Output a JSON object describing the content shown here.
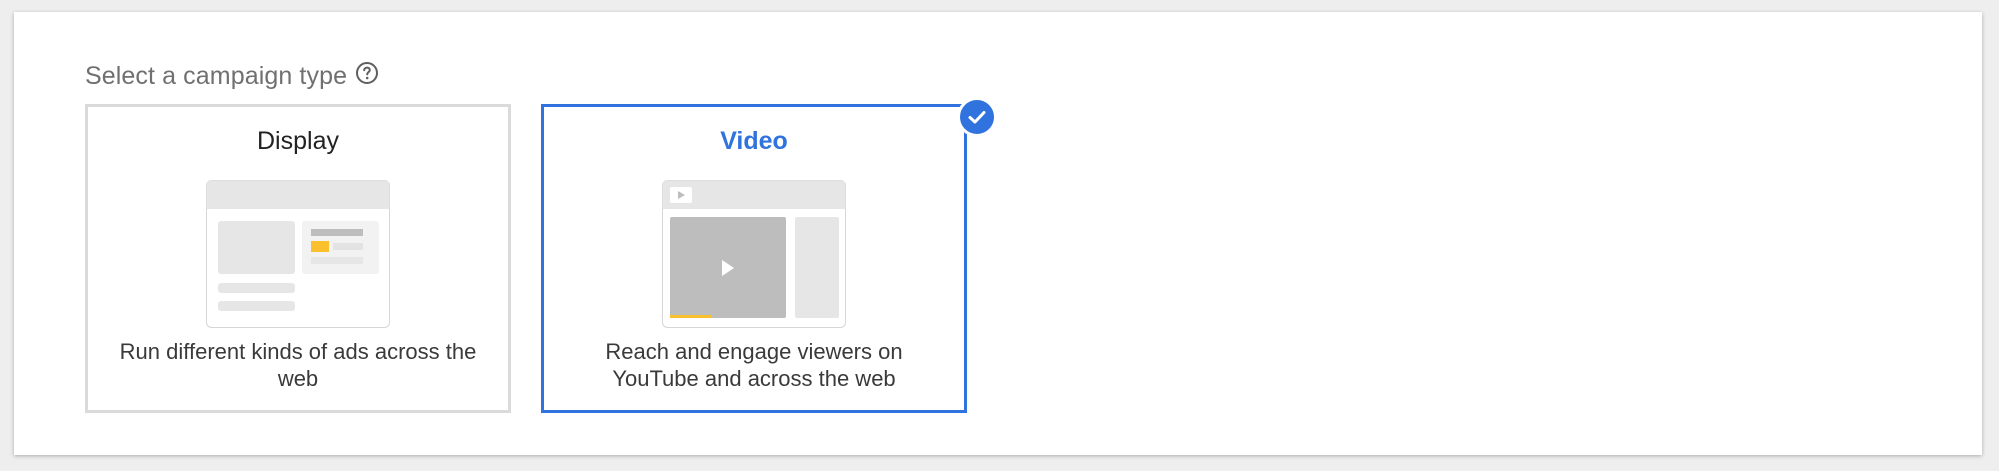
{
  "campaign_selector": {
    "heading": "Select a campaign type",
    "help_icon": "help-circle-icon",
    "selected": "video",
    "accent_color": "#3073de",
    "options": [
      {
        "id": "display",
        "title": "Display",
        "description": "Run different kinds of ads across the web",
        "illustration": "display-ad-illustration",
        "selected": false
      },
      {
        "id": "video",
        "title": "Video",
        "description": "Reach and engage viewers on YouTube and across the web",
        "illustration": "video-player-illustration",
        "selected": true,
        "badge_icon": "check-circle-icon"
      }
    ]
  }
}
